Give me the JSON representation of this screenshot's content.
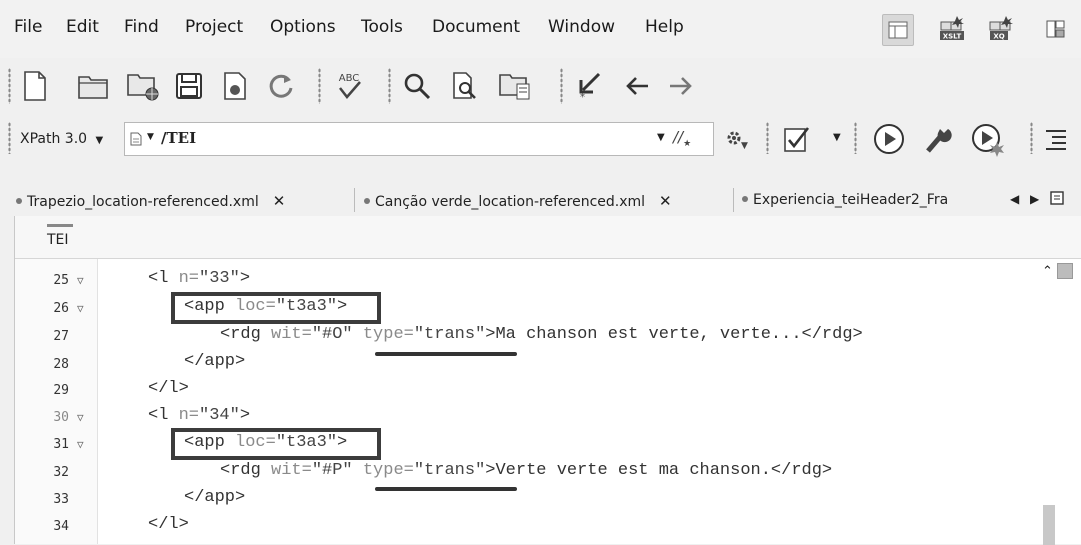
{
  "menu": [
    "File",
    "Edit",
    "Find",
    "Project",
    "Options",
    "Tools",
    "Document",
    "Window",
    "Help"
  ],
  "toolbar_icons": [
    "new-file-icon",
    "open-folder-icon",
    "open-url-icon",
    "save-icon",
    "save-all-icon",
    "reload-icon",
    "spell-check-icon",
    "find-icon",
    "find-in-files-icon",
    "open-file-icon",
    "transform-icon",
    "back-icon",
    "forward-icon"
  ],
  "right_icons": [
    "layout-icon",
    "xslt-debugger-icon",
    "xquery-debugger-icon",
    "perspective-icon"
  ],
  "xpath": {
    "version": "XPath 3.0",
    "path": "/TEI"
  },
  "tabs": [
    {
      "label": "Trapezio_location-referenced.xml"
    },
    {
      "label": "Canção verde_location-referenced.xml"
    },
    {
      "label": "Experiencia_teiHeader2_Fra"
    }
  ],
  "breadcrumb": "TEI",
  "lines": [
    {
      "num": "25",
      "fold": true
    },
    {
      "num": "26",
      "fold": true
    },
    {
      "num": "27",
      "fold": false
    },
    {
      "num": "28",
      "fold": false
    },
    {
      "num": "29",
      "fold": false
    },
    {
      "num": "30",
      "fold": true
    },
    {
      "num": "31",
      "fold": true
    },
    {
      "num": "32",
      "fold": false
    },
    {
      "num": "33",
      "fold": false
    },
    {
      "num": "34",
      "fold": false
    }
  ],
  "code": {
    "l1_open": "<l ",
    "l1_attr": "n=",
    "l1_val": "\"33\"",
    "l1_close": ">",
    "app1_open": "<app ",
    "app1_attr": "loc=",
    "app1_val": "\"t3a3\"",
    "app1_close": ">",
    "rdg1_open": "<rdg ",
    "rdg1_wit": "wit=",
    "rdg1_witval": "\"#O\"",
    "rdg1_type": "type=",
    "rdg1_typeval": "\"trans\"",
    "rdg1_text": ">Ma chanson est verte, verte...</rdg>",
    "app1_end": "</app>",
    "l1_end": "</l>",
    "l2_open": "<l ",
    "l2_attr": "n=",
    "l2_val": "\"34\"",
    "l2_close": ">",
    "app2_open": "<app ",
    "app2_attr": "loc=",
    "app2_val": "\"t3a3\"",
    "app2_close": ">",
    "rdg2_open": "<rdg ",
    "rdg2_wit": "wit=",
    "rdg2_witval": "\"#P\"",
    "rdg2_type": "type=",
    "rdg2_typeval": "\"trans\"",
    "rdg2_text": ">Verte verte est ma chanson.</rdg>",
    "app2_end": "</app>",
    "l2_end": "</l>"
  }
}
